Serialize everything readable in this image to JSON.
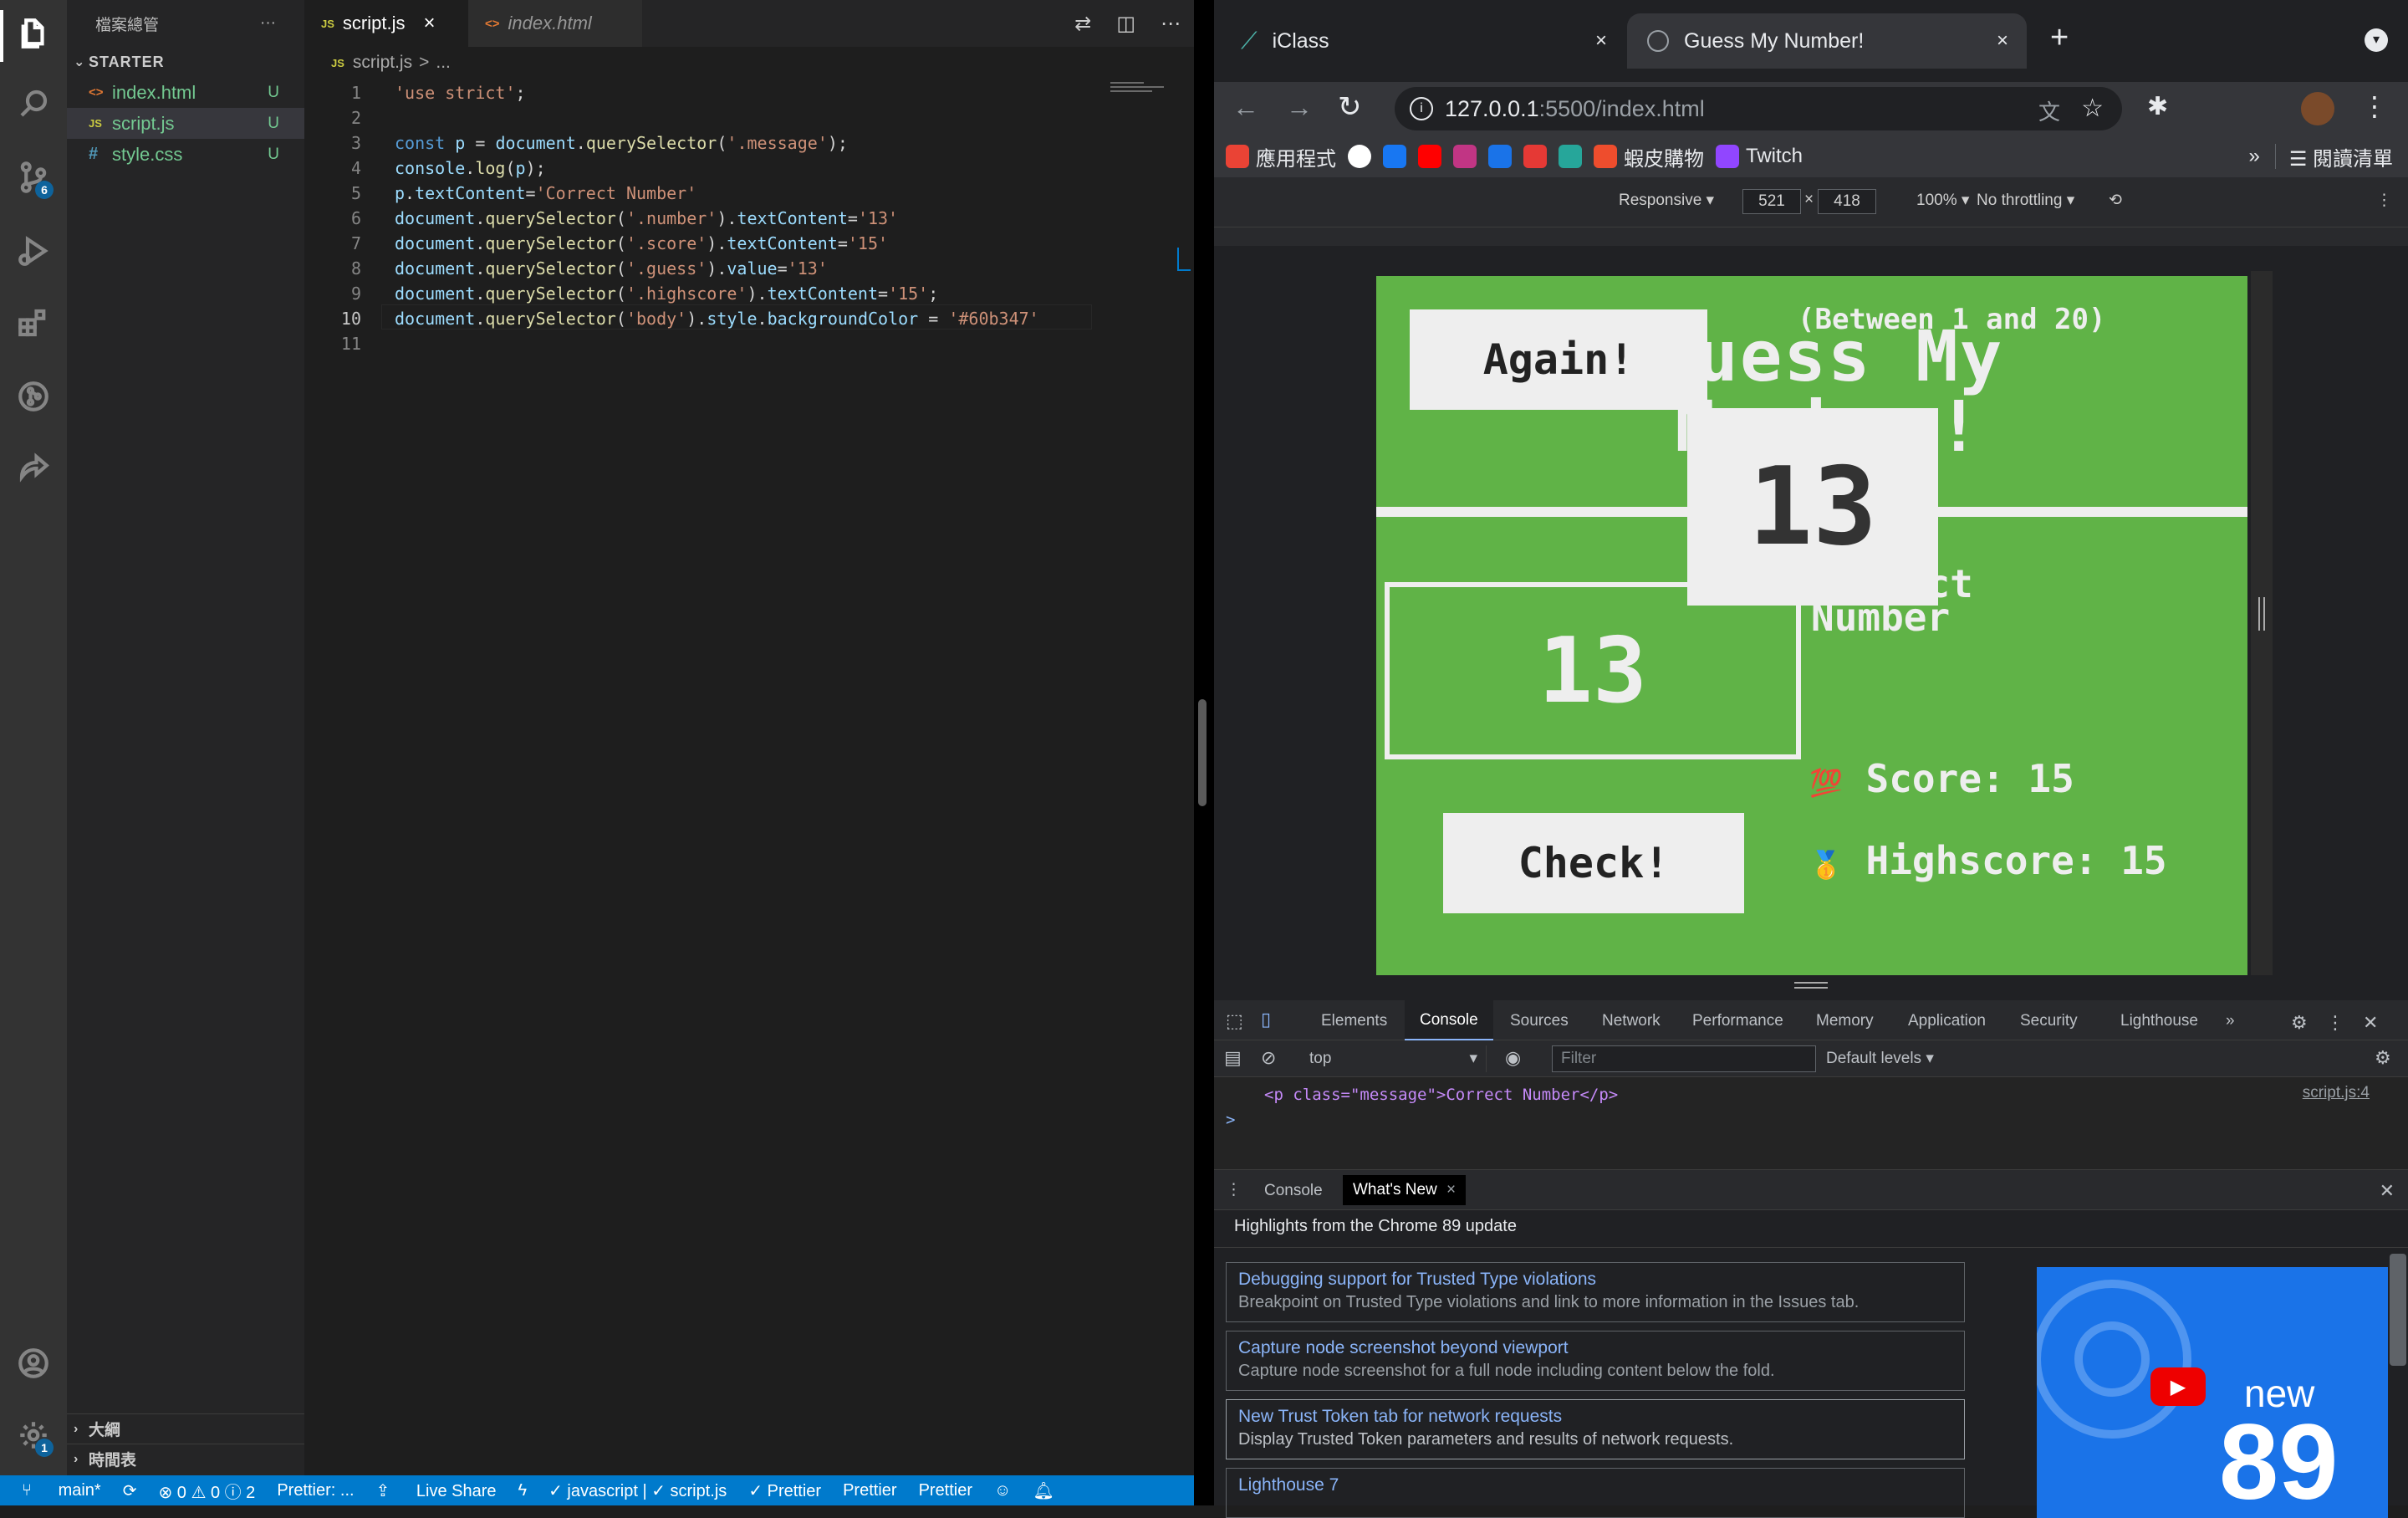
{
  "vscode": {
    "explorer": {
      "title": "檔案總管",
      "more": "···",
      "section": "STARTER",
      "files": [
        {
          "icon": "<>",
          "name": "index.html",
          "status": "U"
        },
        {
          "icon": "JS",
          "name": "script.js",
          "status": "U"
        },
        {
          "icon": "#",
          "name": "style.css",
          "status": "U"
        }
      ],
      "outline": "大綱",
      "timeline": "時間表"
    },
    "activity": {
      "scm_badge": "6",
      "settings_badge": "1"
    },
    "tabs": [
      {
        "icon": "JS",
        "label": "script.js",
        "close": "×"
      },
      {
        "icon": "<>",
        "label": "index.html"
      }
    ],
    "breadcrumb": {
      "icon": "JS",
      "file": "script.js",
      "sep": ">",
      "rest": "..."
    },
    "code": {
      "line_numbers": [
        "1",
        "2",
        "3",
        "4",
        "5",
        "6",
        "7",
        "8",
        "9",
        "10",
        "11"
      ],
      "lines": [
        "'use strict';",
        "",
        "const p = document.querySelector('.message');",
        "console.log(p);",
        "p.textContent='Correct Number'",
        "document.querySelector('.number').textContent='13'",
        "document.querySelector('.score').textContent='15'",
        "document.querySelector('.guess').value='13'",
        "document.querySelector('.highscore').textContent='15';",
        "document.querySelector('body').style.backgroundColor = '#60b347'",
        ""
      ]
    },
    "statusbar": {
      "branch": "main*",
      "sync": "⟳",
      "problems": "⊗ 0 ⚠ 0 ⓘ 2",
      "prettier1": "Prettier: ...",
      "liveshare": "Live Share",
      "lang": "✓ javascript | ✓ script.js",
      "prettier2": "✓ Prettier",
      "prettier3": "Prettier",
      "prettier4": "Prettier"
    }
  },
  "chrome": {
    "tabs": [
      {
        "title": "iClass",
        "close": "×"
      },
      {
        "title": "Guess My Number!",
        "close": "×"
      }
    ],
    "new_tab": "+",
    "url_host": "127.0.0.1",
    "url_rest": ":5500/index.html",
    "bookmarks": [
      {
        "label": "應用程式",
        "color": "#ea4335"
      },
      {
        "label": "",
        "color": "#ffffff"
      },
      {
        "label": "",
        "color": "#1877f2"
      },
      {
        "label": "",
        "color": "#ff0000"
      },
      {
        "label": "",
        "color": "#c13584"
      },
      {
        "label": "",
        "color": "#1a73e8"
      },
      {
        "label": "",
        "color": "#e53935"
      },
      {
        "label": "",
        "color": "#26a69a"
      },
      {
        "label": "蝦皮購物",
        "color": "#ee4d2d"
      },
      {
        "label": "Twitch",
        "color": "#9146ff"
      }
    ],
    "bookmarks_more": "»",
    "reading_list": "閱讀清單",
    "device": {
      "mode": "Responsive ▾",
      "width": "521",
      "times": "×",
      "height": "418",
      "zoom": "100% ▾",
      "throttle": "No throttling ▾"
    }
  },
  "game": {
    "between": "(Between 1 and 20)",
    "title": "Guess My Number!",
    "again": "Again!",
    "number": "13",
    "guess": "13",
    "message": "Correct Number",
    "check": "Check!",
    "score_icon": "💯",
    "score_label": "Score: ",
    "score": "15",
    "highscore_icon": "🥇",
    "highscore_label": "Highscore: ",
    "highscore": "15",
    "bg": "#60b347"
  },
  "devtools": {
    "tabs": [
      "Elements",
      "Console",
      "Sources",
      "Network",
      "Performance",
      "Memory",
      "Application",
      "Security",
      "Lighthouse"
    ],
    "more": "»",
    "context": "top",
    "filter_placeholder": "Filter",
    "levels": "Default levels ▾",
    "log_line": "<p class=\"message\">Correct Number</p>",
    "log_src": "script.js:4",
    "prompt": ">",
    "drawer_tabs": [
      "Console",
      "What's New"
    ],
    "drawer_title": "Highlights from the Chrome 89 update",
    "items": [
      {
        "title": "Debugging support for Trusted Type violations",
        "desc": "Breakpoint on Trusted Type violations and link to more information in the Issues tab."
      },
      {
        "title": "Capture node screenshot beyond viewport",
        "desc": "Capture node screenshot for a full node including content below the fold."
      },
      {
        "title": "New Trust Token tab for network requests",
        "desc": "Display Trusted Token parameters and results of network requests."
      },
      {
        "title": "Lighthouse 7",
        "desc": ""
      }
    ],
    "promo_new": "new",
    "promo_num": "89"
  }
}
